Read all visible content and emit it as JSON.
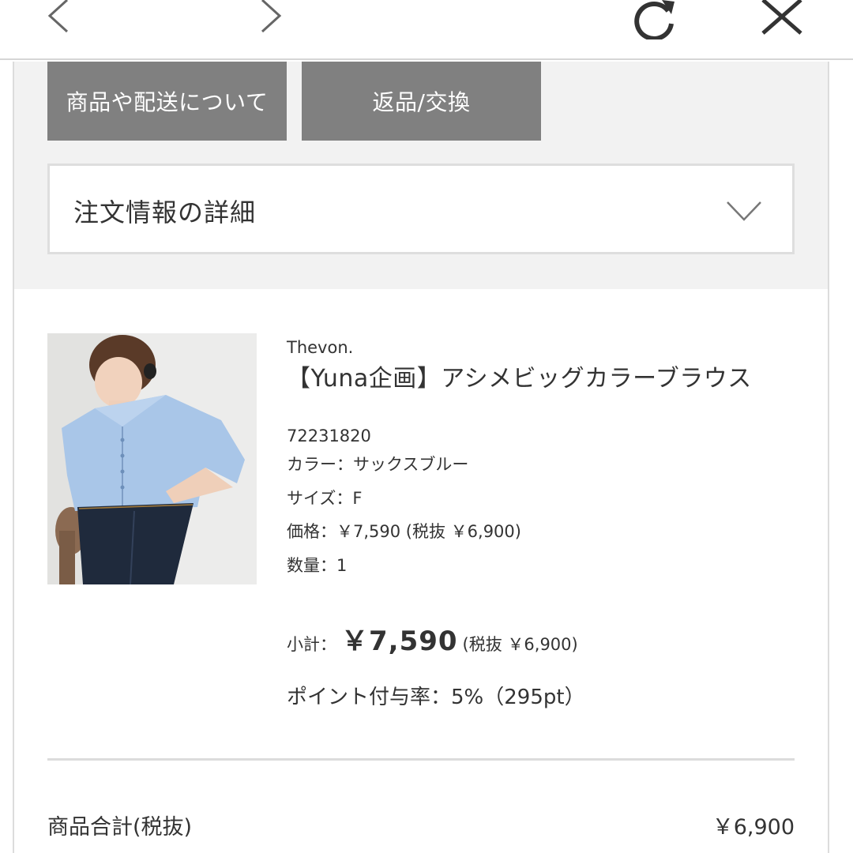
{
  "toolbar": {
    "back_icon": "chevron-left-icon",
    "forward_icon": "chevron-right-icon",
    "reload_icon": "reload-icon",
    "close_icon": "close-icon"
  },
  "tabs": [
    {
      "label": "商品や配送について"
    },
    {
      "label": "返品/交換"
    }
  ],
  "order_details": {
    "title": "注文情報の詳細",
    "icon": "chevron-down-icon"
  },
  "product": {
    "brand": "Thevon.",
    "name": "【Yuna企画】アシメビッグカラーブラウス",
    "code": "72231820",
    "color": "カラー：サックスブルー",
    "size": "サイズ：F",
    "price": "価格：￥7,590 (税抜 ￥6,900)",
    "quantity": "数量：1",
    "subtotal_label": "小計：",
    "subtotal_amount": "￥7,590",
    "subtotal_tax": "(税抜 ￥6,900)",
    "points": "ポイント付与率：5%（295pt）"
  },
  "summary": {
    "label": "商品合計(税抜)",
    "value": "￥6,900"
  },
  "colors": {
    "tab_bg": "#808080",
    "panel_bg": "#f2f2f2",
    "border": "#dcdcdc",
    "text": "#333333",
    "shirt": "#a9c6e8",
    "jeans": "#1f2a3c"
  }
}
